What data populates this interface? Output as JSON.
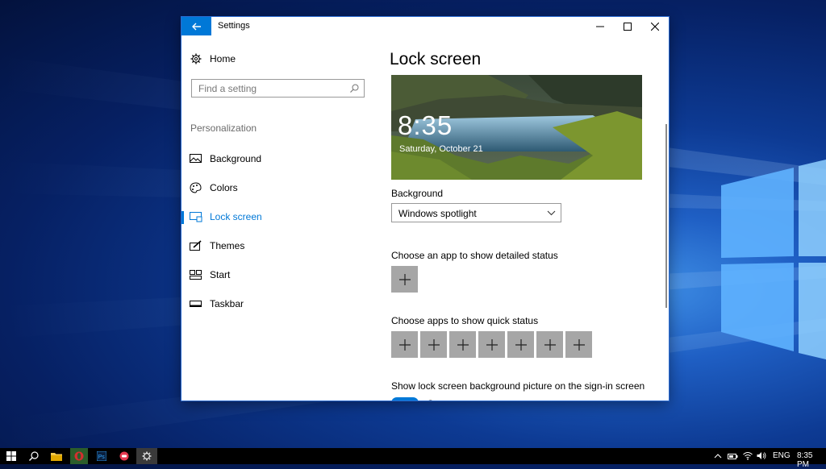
{
  "window": {
    "title": "Settings"
  },
  "nav": {
    "home_label": "Home",
    "search_placeholder": "Find a setting",
    "section_label": "Personalization",
    "items": [
      {
        "label": "Background",
        "icon": "image-icon",
        "active": false
      },
      {
        "label": "Colors",
        "icon": "palette-icon",
        "active": false
      },
      {
        "label": "Lock screen",
        "icon": "lock-screen-icon",
        "active": true
      },
      {
        "label": "Themes",
        "icon": "themes-icon",
        "active": false
      },
      {
        "label": "Start",
        "icon": "start-icon",
        "active": false
      },
      {
        "label": "Taskbar",
        "icon": "taskbar-icon",
        "active": false
      }
    ]
  },
  "main": {
    "title": "Lock screen",
    "preview": {
      "time": "8:35",
      "date": "Saturday, October 21"
    },
    "background_label": "Background",
    "background_value": "Windows spotlight",
    "detailed_status_label": "Choose an app to show detailed status",
    "quick_status_label": "Choose apps to show quick status",
    "quick_status_slots": 7,
    "signin_label": "Show lock screen background picture on the sign-in screen",
    "signin_toggle": "On"
  },
  "taskbar": {
    "language": "ENG",
    "clock": "8:35 PM",
    "pinned": [
      "start-icon",
      "search-icon",
      "file-explorer-icon",
      "opera-icon",
      "photoshop-icon",
      "app-icon",
      "settings-icon"
    ]
  },
  "colors": {
    "accent": "#0078d7",
    "plus_tile": "#a6a6a6"
  }
}
